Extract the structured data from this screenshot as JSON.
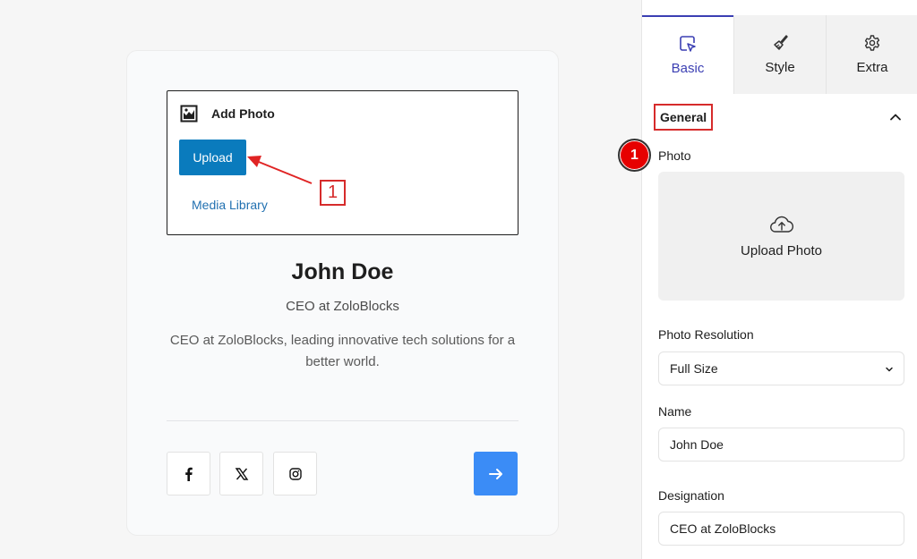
{
  "canvas": {
    "placeholder": {
      "icon": "image-icon",
      "title": "Add Photo",
      "upload_label": "Upload",
      "media_library_label": "Media Library"
    },
    "annotation_box_number": "1",
    "profile": {
      "name": "John Doe",
      "designation": "CEO at ZoloBlocks",
      "bio": "CEO at ZoloBlocks, leading innovative tech solutions for a better world."
    },
    "social": [
      {
        "name": "facebook",
        "icon": "facebook-icon"
      },
      {
        "name": "x",
        "icon": "x-twitter-icon"
      },
      {
        "name": "instagram",
        "icon": "instagram-icon"
      }
    ],
    "action_icon": "arrow-right-icon",
    "colors": {
      "upload_button": "#0a7bbd",
      "action_button": "#3b8cf6",
      "annotation": "#d62b2b"
    }
  },
  "sidebar": {
    "tabs": [
      {
        "label": "Basic",
        "icon": "cursor-square-icon",
        "active": true
      },
      {
        "label": "Style",
        "icon": "brush-icon",
        "active": false
      },
      {
        "label": "Extra",
        "icon": "gear-icon",
        "active": false
      }
    ],
    "section_title": "General",
    "annotation_circle_number": "1",
    "photo_label": "Photo",
    "upload_photo_label": "Upload Photo",
    "photo_resolution_label": "Photo Resolution",
    "photo_resolution_value": "Full Size",
    "name_label": "Name",
    "name_value": "John Doe",
    "designation_label": "Designation",
    "designation_value": "CEO at ZoloBlocks",
    "colors": {
      "active_tab": "#3b3fb3"
    }
  }
}
